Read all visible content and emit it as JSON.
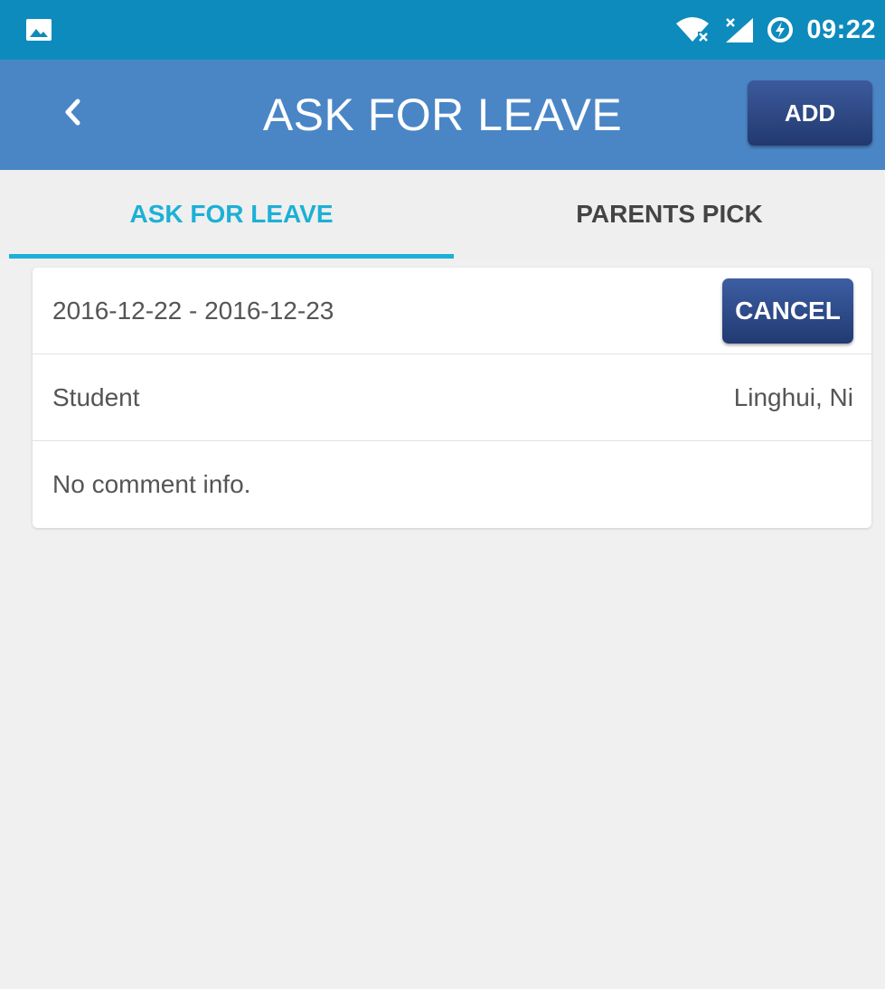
{
  "status_bar": {
    "time": "09:22",
    "icons": [
      "gallery-icon",
      "wifi-icon",
      "signal-icon",
      "data-saver-icon"
    ]
  },
  "app_bar": {
    "back_icon": "chevron-left-icon",
    "title": "ASK FOR LEAVE",
    "add_label": "ADD"
  },
  "tabs": [
    {
      "label": "ASK FOR LEAVE",
      "selected": true
    },
    {
      "label": "PARENTS PICK",
      "selected": false
    }
  ],
  "leave_card": {
    "date_range": "2016-12-22 - 2016-12-23",
    "cancel_label": "CANCEL",
    "student_label": "Student",
    "student_name": "Linghui, Ni",
    "comment": "No comment info."
  },
  "colors": {
    "status_bar": "#0e8bbd",
    "app_bar": "#4a86c6",
    "tab_accent": "#1cb0d6",
    "button": "#2b4580",
    "background": "#f0f0f0"
  }
}
